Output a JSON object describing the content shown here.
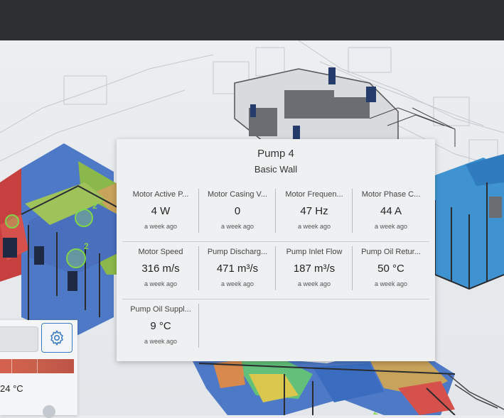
{
  "card": {
    "title": "Pump 4",
    "subtitle": "Basic Wall",
    "rows": [
      [
        {
          "label": "Motor Active P...",
          "value": "4 W",
          "time": "a week ago"
        },
        {
          "label": "Motor Casing V...",
          "value": "0",
          "time": "a week ago"
        },
        {
          "label": "Motor Frequen...",
          "value": "47 Hz",
          "time": "a week ago"
        },
        {
          "label": "Motor Phase C...",
          "value": "44 A",
          "time": "a week ago"
        }
      ],
      [
        {
          "label": "Motor Speed",
          "value": "316 m/s",
          "time": "a week ago"
        },
        {
          "label": "Pump Discharg...",
          "value": "471 m³/s",
          "time": "a week ago"
        },
        {
          "label": "Pump Inlet Flow",
          "value": "187 m³/s",
          "time": "a week ago"
        },
        {
          "label": "Pump Oil Retur...",
          "value": "50 °C",
          "time": "a week ago"
        }
      ],
      [
        {
          "label": "Pump Oil Suppl...",
          "value": "9 °C",
          "time": "a week ago"
        }
      ]
    ]
  },
  "panel": {
    "temp_label": "24 °C",
    "gradient_start": "#d4624f",
    "gradient_end": "#bd5348",
    "settings_icon": "gear-icon"
  },
  "scene": {
    "markers": [
      "2",
      "2",
      "2"
    ],
    "sensor_color": "#9be36a"
  },
  "colors": {
    "topbar": "#2d2f33",
    "accent": "#3a7cc3"
  }
}
